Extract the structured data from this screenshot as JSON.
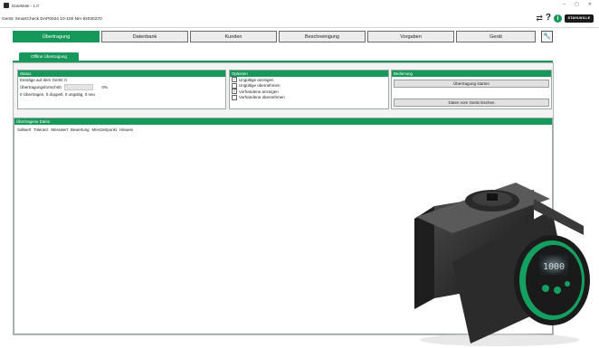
{
  "window": {
    "title": "DatoMate - 1.0",
    "controls": [
      "–",
      "▢",
      "✕"
    ]
  },
  "device_bar": {
    "device_label": "Gerät:",
    "device_name": "SmartCheck DAP0024",
    "range": "10-100 Nm",
    "serial": "92030270"
  },
  "icons": {
    "transfer": "⇄",
    "help": "?",
    "info": "i",
    "brand": "STAHLWILLE",
    "settings": "🔧"
  },
  "tabs": [
    {
      "label": "Übertragung",
      "active": true
    },
    {
      "label": "Datenbank"
    },
    {
      "label": "Kunden"
    },
    {
      "label": "Beschreinigung"
    },
    {
      "label": "Vorgaben"
    },
    {
      "label": "Gerät"
    }
  ],
  "subtab": {
    "label": "Offline Übertragung"
  },
  "status": {
    "title": "Status",
    "entries_label": "Einträge auf dem Gerät: 0",
    "progress_label": "Übertragungsfortschritt",
    "progress_value": 0,
    "progress_pct": "0%",
    "summary": "0 Übertragen, 0 doppelt, 0 ungültig, 0 neu"
  },
  "options": {
    "title": "Optionen",
    "items": [
      {
        "label": "Ungültige anzeigen",
        "checked": true
      },
      {
        "label": "Ungültige übernehmen",
        "checked": false
      },
      {
        "label": "Vorhandene anzeigen",
        "checked": true
      },
      {
        "label": "Vorhandene übernehmen",
        "checked": false
      }
    ]
  },
  "control": {
    "title": "Bedienung",
    "start_button": "Übertragung starten",
    "delete_button": "Daten vom Gerät löschen"
  },
  "data_panel": {
    "title": "Übertragene Daten",
    "columns": [
      "Sollwert",
      "Toleranz",
      "Messwert",
      "Bewertung",
      "Messzeitpunkt",
      "Hinweis"
    ]
  },
  "colors": {
    "accent": "#15985a"
  }
}
